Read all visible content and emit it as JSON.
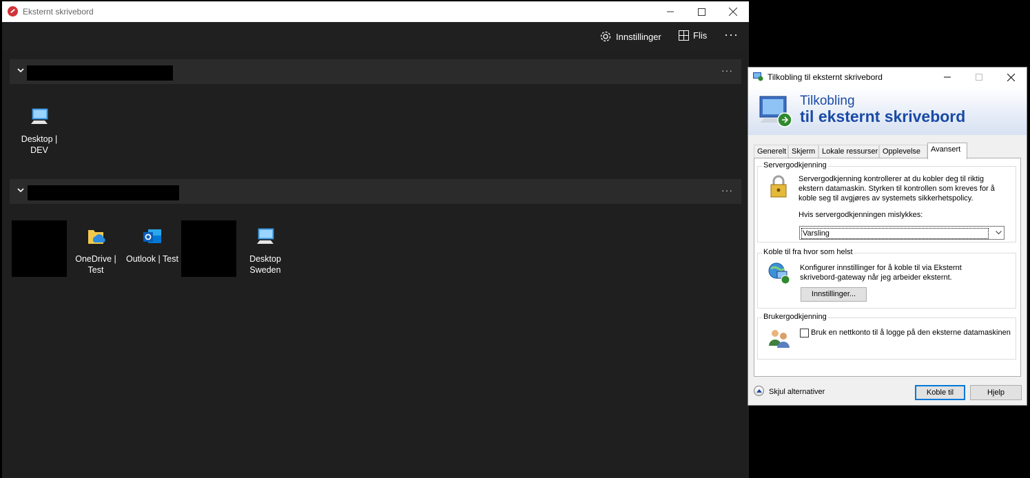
{
  "main_window": {
    "title": "Eksternt skrivebord",
    "toolbar": {
      "settings_label": "Innstillinger",
      "tiles_label": "Flis",
      "more_label": "···"
    },
    "groups": [
      {
        "more_label": "···",
        "tiles": [
          {
            "label": "Desktop | DEV",
            "icon": "desktop-icon"
          }
        ]
      },
      {
        "more_label": "···",
        "tiles": [
          {
            "label": "OneDrive | Test",
            "icon": "onedrive-icon"
          },
          {
            "label": "Outlook | Test",
            "icon": "outlook-icon"
          },
          {
            "label": "Desktop Sweden",
            "icon": "desktop-icon"
          }
        ]
      }
    ]
  },
  "dialog": {
    "title": "Tilkobling til eksternt skrivebord",
    "banner_line1": "Tilkobling",
    "banner_line2": "til eksternt skrivebord",
    "tabs": [
      "Generelt",
      "Skjerm",
      "Lokale ressurser",
      "Opplevelse",
      "Avansert"
    ],
    "active_tab": "Avansert",
    "server_auth": {
      "legend": "Servergodkjenning",
      "description": "Servergodkjenning kontrollerer at du kobler deg til riktig ekstern datamaskin. Styrken til kontrollen som kreves for å koble seg til avgjøres av systemets sikkerhetspolicy.",
      "dropdown_label": "Hvis servergodkjenningen mislykkes:",
      "dropdown_value": "Varsling"
    },
    "connect_anywhere": {
      "legend": "Koble til fra hvor som helst",
      "description": "Konfigurer innstillinger for å koble til via Eksternt skrivebord-gateway når jeg arbeider eksternt.",
      "settings_button": "Innstillinger..."
    },
    "user_auth": {
      "legend": "Brukergodkjenning",
      "checkbox_label": "Bruk en nettkonto til å logge på den eksterne datamaskinen",
      "checked": false
    },
    "footer": {
      "hide_options": "Skjul alternativer",
      "connect_button": "Koble til",
      "help_button": "Hjelp"
    }
  }
}
